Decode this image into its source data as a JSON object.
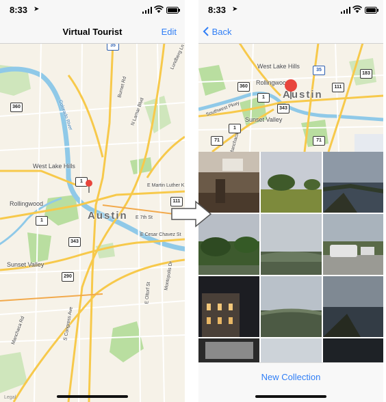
{
  "left": {
    "status_time": "8:33",
    "nav_title": "Virtual Tourist",
    "edit_label": "Edit",
    "map": {
      "city": "Austin",
      "places": [
        "West Lake Hills",
        "Rollingwood",
        "Sunset Valley"
      ],
      "streets": [
        "E Martin Luther K",
        "E 7th St",
        "E Cesar Chavez St",
        "Burnet Rd",
        "N Lamar Blvd",
        "Lundberg Ln",
        "Montopolis Dr",
        "Manchaca Rd",
        "S Congress Ave",
        "E Oltorf St",
        "Colorado River"
      ],
      "shields": [
        "360",
        "1",
        "1",
        "343",
        "290",
        "111",
        "35"
      ],
      "legal": "Legal"
    }
  },
  "right": {
    "status_time": "8:33",
    "back_label": "Back",
    "map": {
      "city": "Austin",
      "places": [
        "West Lake Hills",
        "Rollingwood",
        "Sunset Valley"
      ],
      "streets": [
        "Southwest Pkwy",
        "Manchaca Ln"
      ],
      "shields": [
        "35",
        "183",
        "360",
        "1",
        "111",
        "343",
        "1",
        "71",
        "71"
      ]
    },
    "photos": [
      "room-interior",
      "green-field",
      "lake-view",
      "park-trees",
      "cloudy-hills",
      "rv-parking",
      "night-building",
      "cloudy-valley",
      "lake-dusk",
      "dark-interior",
      "overcast-sky",
      "dark-water"
    ],
    "new_collection_label": "New Collection"
  },
  "colors": {
    "accent": "#2f7ef6",
    "pin": "#e8453c",
    "map_bg": "#f6f2e8",
    "road": "#f7c94b",
    "water": "#8fc9e8",
    "park": "#b9dea0"
  }
}
